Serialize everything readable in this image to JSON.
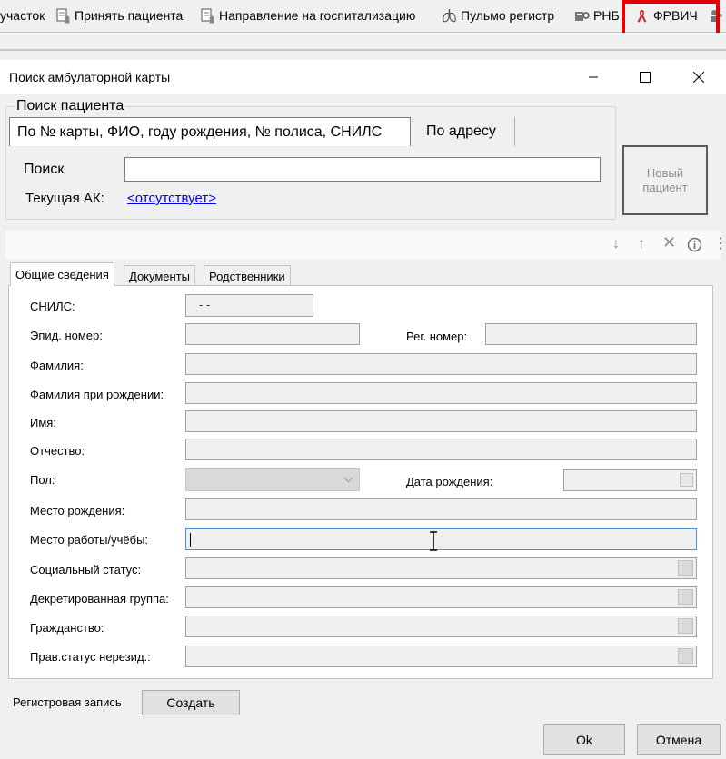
{
  "toolbar": {
    "items": [
      {
        "label": "участок",
        "icon": "none"
      },
      {
        "label": "Принять пациента",
        "icon": "doc-person-icon"
      },
      {
        "label": "Направление на госпитализацию",
        "icon": "doc-person-icon"
      },
      {
        "label": "Пульмо регистр",
        "icon": "lungs-icon"
      },
      {
        "label": "РНБ",
        "icon": "registry-icon"
      },
      {
        "label": "ФРВИЧ",
        "icon": "red-ribbon-icon"
      }
    ],
    "highlight_color": "#e30000"
  },
  "dialog": {
    "title": "Поиск амбулаторной карты",
    "search_group": {
      "legend": "Поиск пациента",
      "tabs": [
        "По № карты, ФИО, году рождения, № полиса, СНИЛС",
        "По адресу"
      ],
      "search_label": "Поиск",
      "search_value": "",
      "current_ak_label": "Текущая АК:",
      "current_ak_value": "<отсутствует>"
    },
    "new_patient_button": "Новый\nпациент",
    "detail_tabs": [
      "Общие сведения",
      "Документы",
      "Родственники"
    ],
    "fields": {
      "snils_label": "СНИЛС:",
      "snils_value": "-  -",
      "epid_label": "Эпид. номер:",
      "reg_label": "Рег. номер:",
      "surname_label": "Фамилия:",
      "birth_surname_label": "Фамилия при рождении:",
      "name_label": "Имя:",
      "patronymic_label": "Отчество:",
      "sex_label": "Пол:",
      "birthdate_label": "Дата рождения:",
      "birthplace_label": "Место рождения:",
      "workplace_label": "Место работы/учёбы:",
      "social_label": "Социальный статус:",
      "decree_label": "Декретированная группа:",
      "citizenship_label": "Гражданство:",
      "legal_label": "Прав.статус нерезид.:"
    },
    "registry_label": "Регистровая запись",
    "create_button": "Создать",
    "ok_button": "Ok",
    "cancel_button": "Отмена"
  }
}
